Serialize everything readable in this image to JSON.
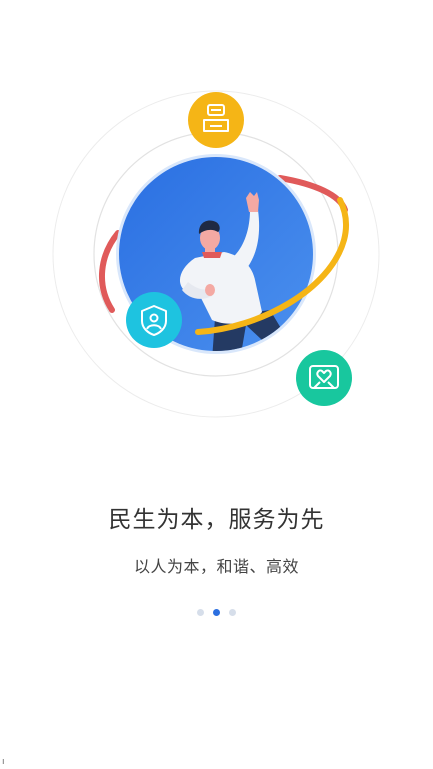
{
  "onboarding": {
    "title": "民生为本，服务为先",
    "subtitle": "以人为本，和谐、高效",
    "page_indicator": {
      "total": 3,
      "current": 2
    }
  },
  "illustration": {
    "icons": [
      "service-counter-icon",
      "shield-person-icon",
      "heart-hands-icon"
    ],
    "colors": {
      "blue_circle": "#2f79e6",
      "yellow_badge": "#f5b516",
      "cyan_badge": "#1ec3e0",
      "green_badge": "#18c79e",
      "red_arc": "#e05a5a",
      "yellow_arc": "#f5b516",
      "ring": "#e6e6e6",
      "active_dot": "#2b6fe0",
      "inactive_dot": "#d6deea"
    }
  }
}
